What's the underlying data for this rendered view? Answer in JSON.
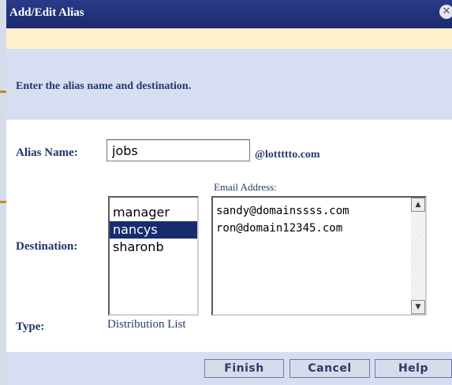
{
  "dialog": {
    "title": "Add/Edit Alias",
    "close_icon": "close-icon",
    "instructions": "Enter the alias name and destination."
  },
  "form": {
    "alias_label": "Alias Name:",
    "alias_value": "jobs",
    "domain_suffix": "@lottttto.com",
    "destination_label": "Destination:",
    "email_address_label": "Email Address:",
    "destinations": [
      "manager",
      "nancys",
      "sharonb"
    ],
    "selected_destination": "nancys",
    "email_addresses": [
      "sandy@domainssss.com",
      "ron@domain12345.com"
    ],
    "type_label": "Type:",
    "type_value": "Distribution List"
  },
  "buttons": {
    "finish": "Finish",
    "cancel": "Cancel",
    "help": "Help"
  },
  "colors": {
    "titlebar": "#1c2a70",
    "panel": "#d7def1",
    "selection": "#172c6e",
    "label_text": "#1f3468"
  }
}
